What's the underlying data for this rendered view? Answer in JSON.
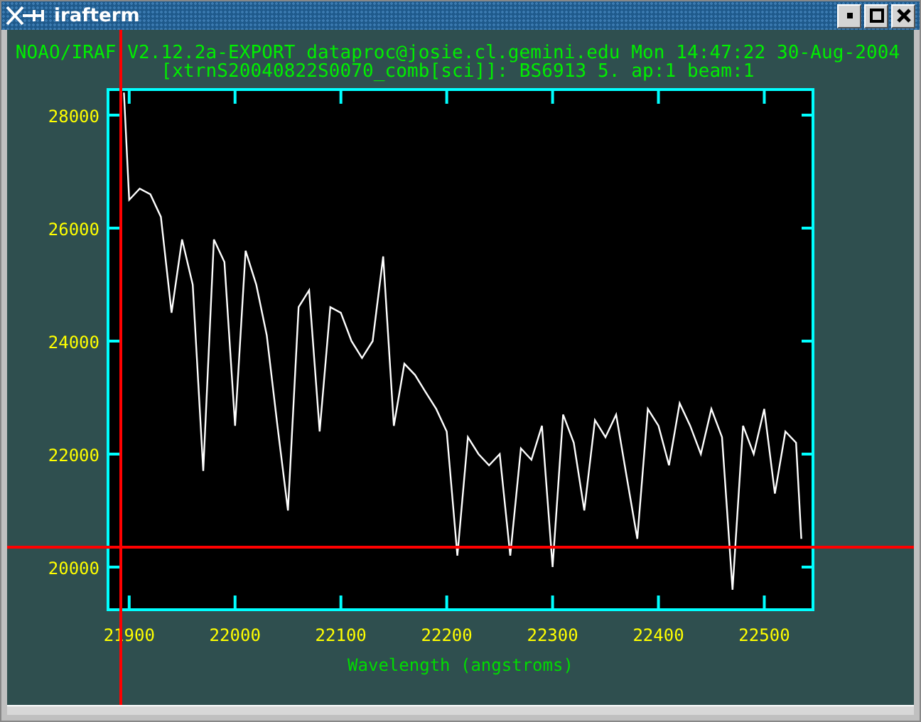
{
  "window": {
    "title": "irafterm"
  },
  "header": [
    "NOAO/IRAF V2.12.2a-EXPORT dataproc@josie.cl.gemini.edu Mon 14:47:22 30-Aug-2004",
    "[xtrnS20040822S0070_comb[sci]]: BS6913 5. ap:1 beam:1"
  ],
  "plot": {
    "chart_data": {
      "type": "line",
      "xlabel": "Wavelength (angstroms)",
      "xlim": [
        21880,
        22546
      ],
      "ylim": [
        19245,
        28453
      ],
      "xticks": [
        21900,
        22000,
        22100,
        22200,
        22300,
        22400,
        22500
      ],
      "yticks": [
        20000,
        22000,
        24000,
        26000,
        28000
      ],
      "x": [
        21895,
        21900,
        21910,
        21920,
        21930,
        21940,
        21950,
        21960,
        21970,
        21980,
        21990,
        22000,
        22010,
        22020,
        22030,
        22040,
        22050,
        22060,
        22070,
        22080,
        22090,
        22100,
        22110,
        22120,
        22130,
        22140,
        22150,
        22160,
        22170,
        22180,
        22190,
        22200,
        22210,
        22220,
        22230,
        22240,
        22250,
        22260,
        22270,
        22280,
        22290,
        22300,
        22310,
        22320,
        22330,
        22340,
        22350,
        22360,
        22370,
        22380,
        22390,
        22400,
        22410,
        22420,
        22430,
        22440,
        22450,
        22460,
        22470,
        22480,
        22490,
        22500,
        22510,
        22520,
        22530,
        22535
      ],
      "series": [
        {
          "color": "#ffffff",
          "values": [
            28400,
            26500,
            26700,
            26600,
            26200,
            24500,
            25800,
            25000,
            21700,
            25800,
            25400,
            22500,
            25600,
            25000,
            24100,
            22500,
            21000,
            24600,
            24900,
            22400,
            24600,
            24500,
            24000,
            23700,
            24000,
            25500,
            22500,
            23600,
            23400,
            23100,
            22800,
            22400,
            20200,
            22300,
            22000,
            21800,
            22000,
            20200,
            22100,
            21900,
            22500,
            20000,
            22700,
            22200,
            21000,
            22600,
            22300,
            22700,
            21600,
            20500,
            22800,
            22500,
            21800,
            22900,
            22500,
            22000,
            22800,
            22300,
            19600,
            22500,
            22000,
            22800,
            21300,
            22400,
            22200,
            20500
          ]
        }
      ]
    }
  }
}
